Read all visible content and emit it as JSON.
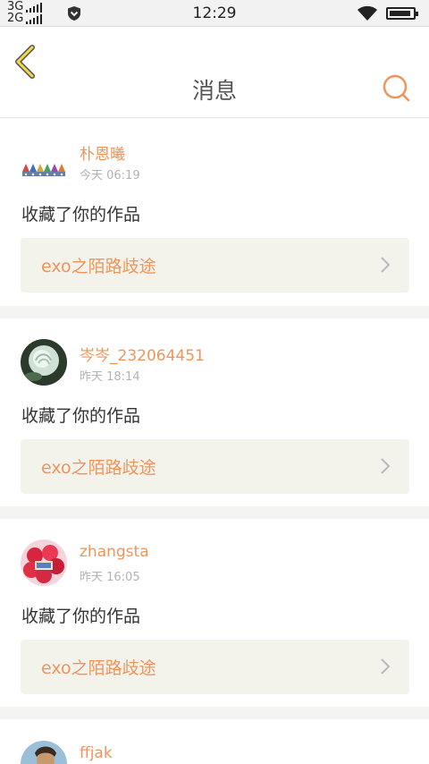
{
  "status_bar": {
    "network_top": "3G",
    "network_bottom": "2G",
    "time": "12:29",
    "icons": [
      "shield-icon",
      "wifi-icon",
      "battery-icon"
    ],
    "battery_level": 0.9
  },
  "header": {
    "title": "消息",
    "back_icon": "chevron-left-icon",
    "search_icon": "search-icon",
    "accent_color": "#f0945a"
  },
  "messages": [
    {
      "username": "朴恩曦",
      "time": "今天 06:19",
      "action": "收藏了你的作品",
      "work_title": "exo之陌路歧途"
    },
    {
      "username": "岑岑_232064451",
      "time": "昨天 18:14",
      "action": "收藏了你的作品",
      "work_title": "exo之陌路歧途"
    },
    {
      "username": "zhangsta",
      "time": "昨天 16:05",
      "action": "收藏了你的作品",
      "work_title": "exo之陌路歧途"
    },
    {
      "username": "ffjak"
    }
  ]
}
